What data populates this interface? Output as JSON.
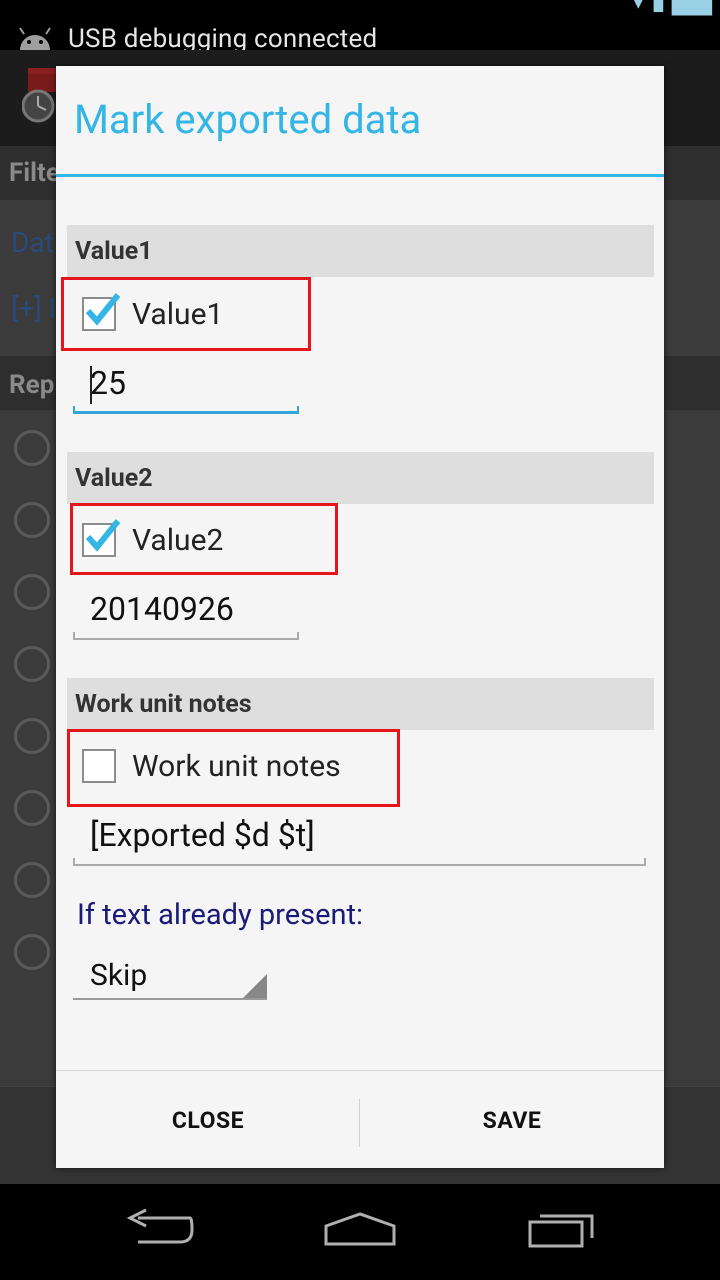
{
  "status_bar": {
    "notification_text": "USB debugging connected"
  },
  "dialog": {
    "title": "Mark exported data",
    "sections": [
      {
        "header": "Value1",
        "checkbox_label": "Value1",
        "checked": true,
        "field_value": "25"
      },
      {
        "header": "Value2",
        "checkbox_label": "Value2",
        "checked": true,
        "field_value": "20140926"
      },
      {
        "header": "Work unit notes",
        "checkbox_label": "Work unit notes",
        "checked": false,
        "field_value": "[Exported $d $t]"
      }
    ],
    "prompt": "If text already present:",
    "spinner_value": "Skip",
    "buttons": {
      "close": "CLOSE",
      "save": "SAVE"
    }
  },
  "background": {
    "filter_header": "Filte",
    "date_link": "Dat",
    "add_link": "[+] I",
    "report_header": "Rep"
  },
  "colors": {
    "accent": "#33b5e5",
    "highlight": "#e8141c",
    "prompt": "#1a1a78"
  }
}
